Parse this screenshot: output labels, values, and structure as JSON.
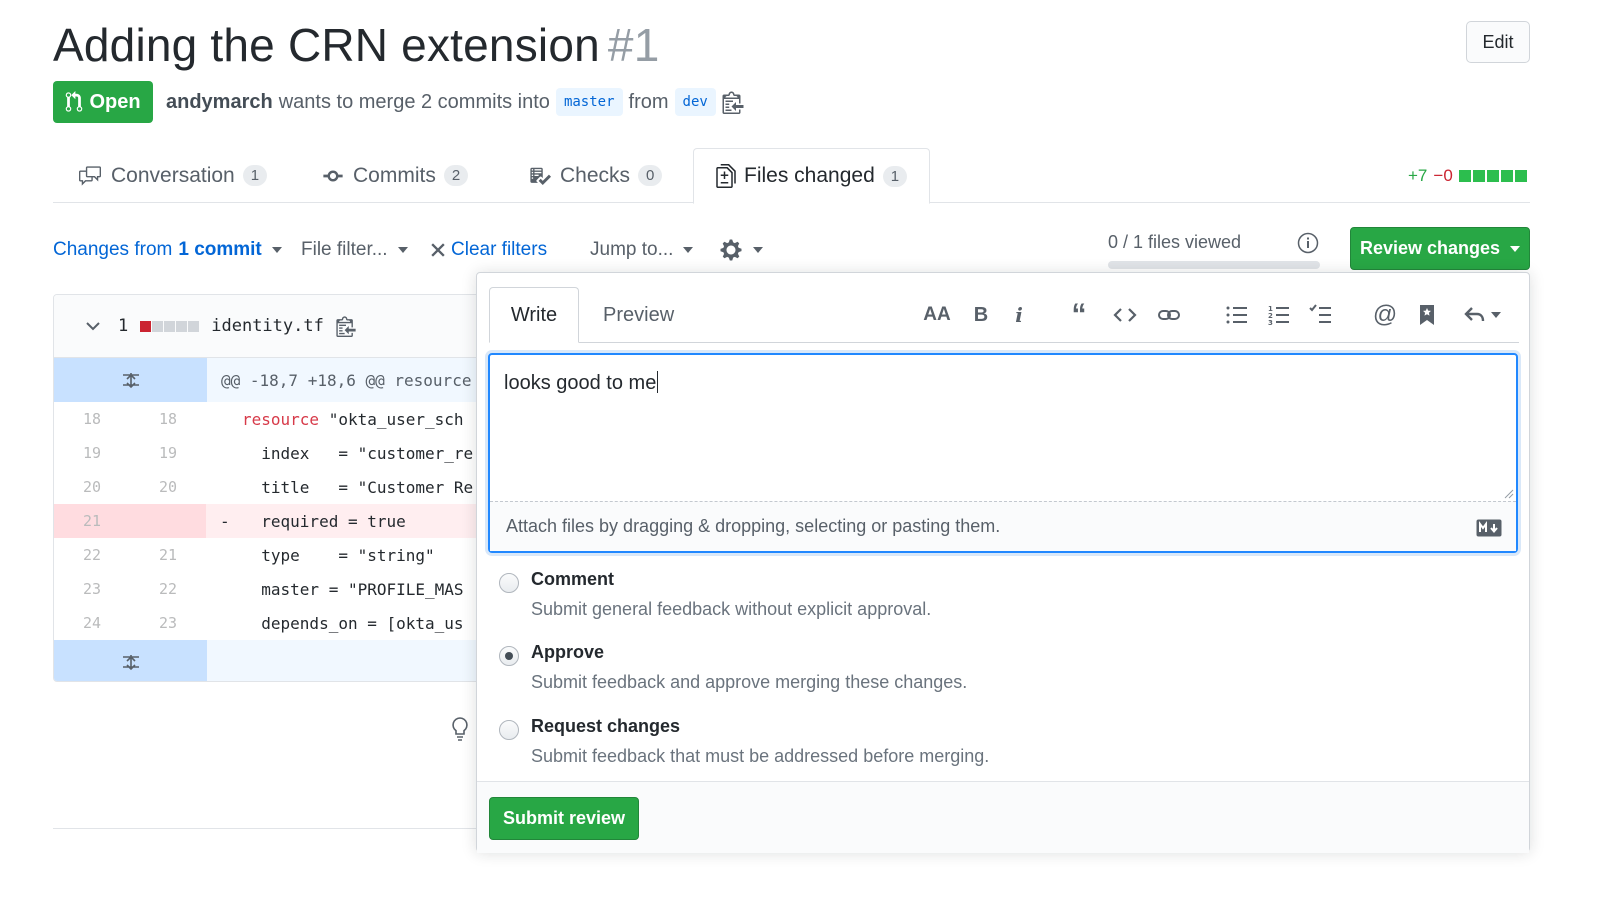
{
  "header": {
    "title": "Adding the CRN extension",
    "number": "#1",
    "edit_label": "Edit",
    "state": "Open",
    "author": "andymarch",
    "merge_text": "wants to merge 2 commits into",
    "base_branch": "master",
    "from_text": "from",
    "head_branch": "dev"
  },
  "tabs": [
    {
      "label": "Conversation",
      "count": "1",
      "icon": "comment-discussion-icon"
    },
    {
      "label": "Commits",
      "count": "2",
      "icon": "git-commit-icon"
    },
    {
      "label": "Checks",
      "count": "0",
      "icon": "checklist-icon"
    },
    {
      "label": "Files changed",
      "count": "1",
      "icon": "file-diff-icon",
      "active": true
    }
  ],
  "diffstat": {
    "additions": "+7",
    "deletions": "−0"
  },
  "toolbar": {
    "changes_prefix": "Changes from",
    "changes_commit": "1 commit",
    "file_filter": "File filter...",
    "clear_filters": "Clear filters",
    "jump_to": "Jump to...",
    "files_viewed": "0 / 1 files viewed",
    "review_changes": "Review changes"
  },
  "diff": {
    "count": "1",
    "filename": "identity.tf",
    "hunk_header": "@@ -18,7 +18,6 @@ resource",
    "lines": [
      {
        "old": "18",
        "new": "18",
        "sign": "",
        "kw": "resource",
        "rest": " \"okta_user_sch"
      },
      {
        "old": "19",
        "new": "19",
        "sign": "",
        "kw": "",
        "rest": "  index   = \"customer_re"
      },
      {
        "old": "20",
        "new": "20",
        "sign": "",
        "kw": "",
        "rest": "  title   = \"Customer Re"
      },
      {
        "old": "21",
        "new": "",
        "sign": "-",
        "kw": "",
        "rest": "  required = true",
        "deleted": true
      },
      {
        "old": "22",
        "new": "21",
        "sign": "",
        "kw": "",
        "rest": "  type    = \"string\""
      },
      {
        "old": "23",
        "new": "22",
        "sign": "",
        "kw": "",
        "rest": "  master = \"PROFILE_MAS"
      },
      {
        "old": "24",
        "new": "23",
        "sign": "",
        "kw": "",
        "rest": "  depends_on = [okta_us"
      }
    ]
  },
  "review": {
    "write_tab": "Write",
    "preview_tab": "Preview",
    "body": "looks good to me",
    "attach_hint": "Attach files by dragging & dropping, selecting or pasting them.",
    "options": [
      {
        "label": "Comment",
        "desc": "Submit general feedback without explicit approval.",
        "checked": false
      },
      {
        "label": "Approve",
        "desc": "Submit feedback and approve merging these changes.",
        "checked": true
      },
      {
        "label": "Request changes",
        "desc": "Submit feedback that must be addressed before merging.",
        "checked": false
      }
    ],
    "submit_label": "Submit review"
  },
  "colors": {
    "primary_green": "#28a745",
    "link_blue": "#0366d6",
    "deletion_red": "#cb2431"
  }
}
